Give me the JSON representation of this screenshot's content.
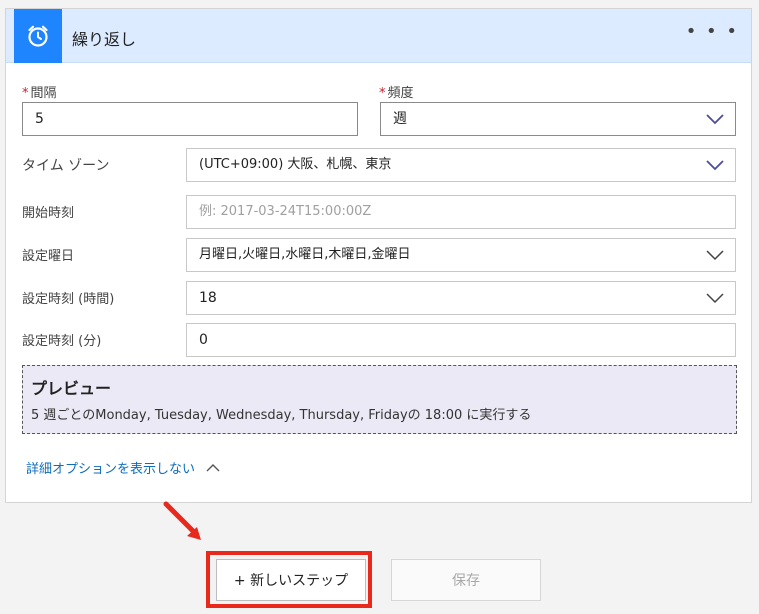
{
  "header": {
    "title": "繰り返し",
    "more_label": "• • •",
    "icon": "alarm-clock-icon"
  },
  "interval": {
    "label": "間隔",
    "required_mark": "*",
    "value": "5"
  },
  "frequency": {
    "label": "頻度",
    "required_mark": "*",
    "value": "週"
  },
  "timezone": {
    "label": "タイム ゾーン",
    "value": "(UTC+09:00) 大阪、札幌、東京"
  },
  "start_time": {
    "label": "開始時刻",
    "placeholder": "例: 2017-03-24T15:00:00Z"
  },
  "weekdays": {
    "label": "設定曜日",
    "value": "月曜日,火曜日,水曜日,木曜日,金曜日"
  },
  "hours": {
    "label": "設定時刻 (時間)",
    "value": "18"
  },
  "minutes": {
    "label": "設定時刻 (分)",
    "value": "0"
  },
  "preview": {
    "title": "プレビュー",
    "text": "5 週ごとのMonday, Tuesday, Wednesday, Thursday, Fridayの 18:00 に実行する"
  },
  "advanced_link": {
    "label": "詳細オプションを表示しない"
  },
  "footer": {
    "new_step_label": "+ 新しいステップ",
    "save_label": "保存"
  },
  "colors": {
    "accent": "#1f85ff",
    "header_bg": "#dcebff",
    "link": "#0f6cbd",
    "highlight": "#e8291c",
    "required": "#c7202b"
  }
}
